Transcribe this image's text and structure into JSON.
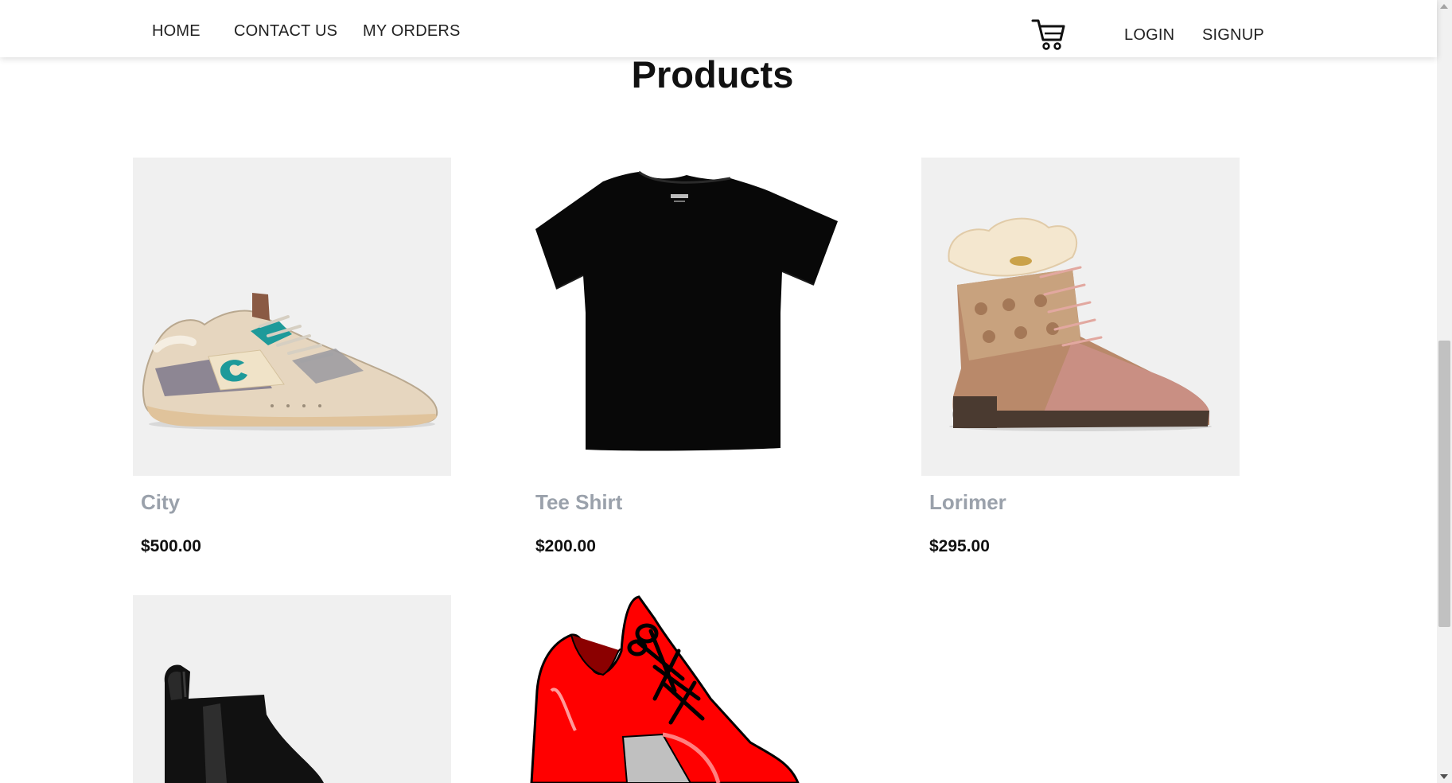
{
  "nav": {
    "home": "HOME",
    "contact": "CONTACT US",
    "orders": "MY ORDERS",
    "login": "LOGIN",
    "signup": "SIGNUP",
    "cart_icon": "shopping-cart-icon"
  },
  "page": {
    "title": "Products"
  },
  "products": [
    {
      "name": "City",
      "price": "$500.00",
      "image": "beige-sneaker"
    },
    {
      "name": "Tee Shirt",
      "price": "$200.00",
      "image": "black-tee-shirt"
    },
    {
      "name": "Lorimer",
      "price": "$295.00",
      "image": "pink-fur-boot"
    },
    {
      "image": "black-chelsea-boot"
    },
    {
      "image": "red-cartoon-sneaker"
    }
  ],
  "colors": {
    "image_bg": "#f0f0f0",
    "product_name": "#9aa1ab",
    "price": "#111111",
    "teal_accent": "#1e9a9a",
    "red_shoe": "#ff0000"
  }
}
